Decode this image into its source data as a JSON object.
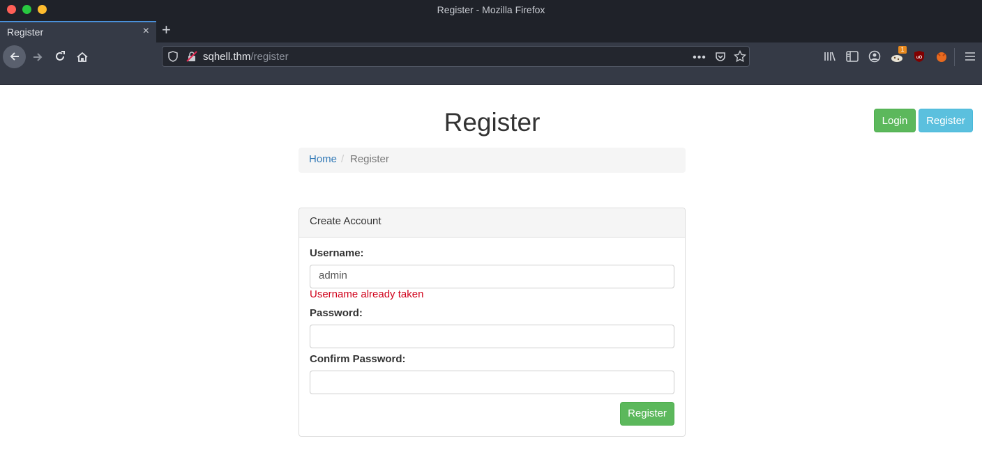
{
  "window": {
    "title": "Register - Mozilla Firefox",
    "colors": {
      "close": "#ff5f57",
      "minimize": "#28c840",
      "maximize": "#febc2e"
    }
  },
  "tabs": [
    {
      "label": "Register",
      "close": "×"
    }
  ],
  "newtab_label": "+",
  "urlbar": {
    "host": "sqhell.thm",
    "path": "/register"
  },
  "toolbar": {
    "badge_count": "1"
  },
  "page": {
    "title": "Register",
    "login_label": "Login",
    "register_label": "Register",
    "breadcrumb": {
      "home": "Home",
      "separator": "/",
      "current": "Register"
    },
    "panel": {
      "title": "Create Account",
      "username_label": "Username:",
      "username_value": "admin",
      "username_error": "Username already taken",
      "password_label": "Password:",
      "password_value": "",
      "confirm_label": "Confirm Password:",
      "confirm_value": "",
      "submit_label": "Register"
    }
  }
}
